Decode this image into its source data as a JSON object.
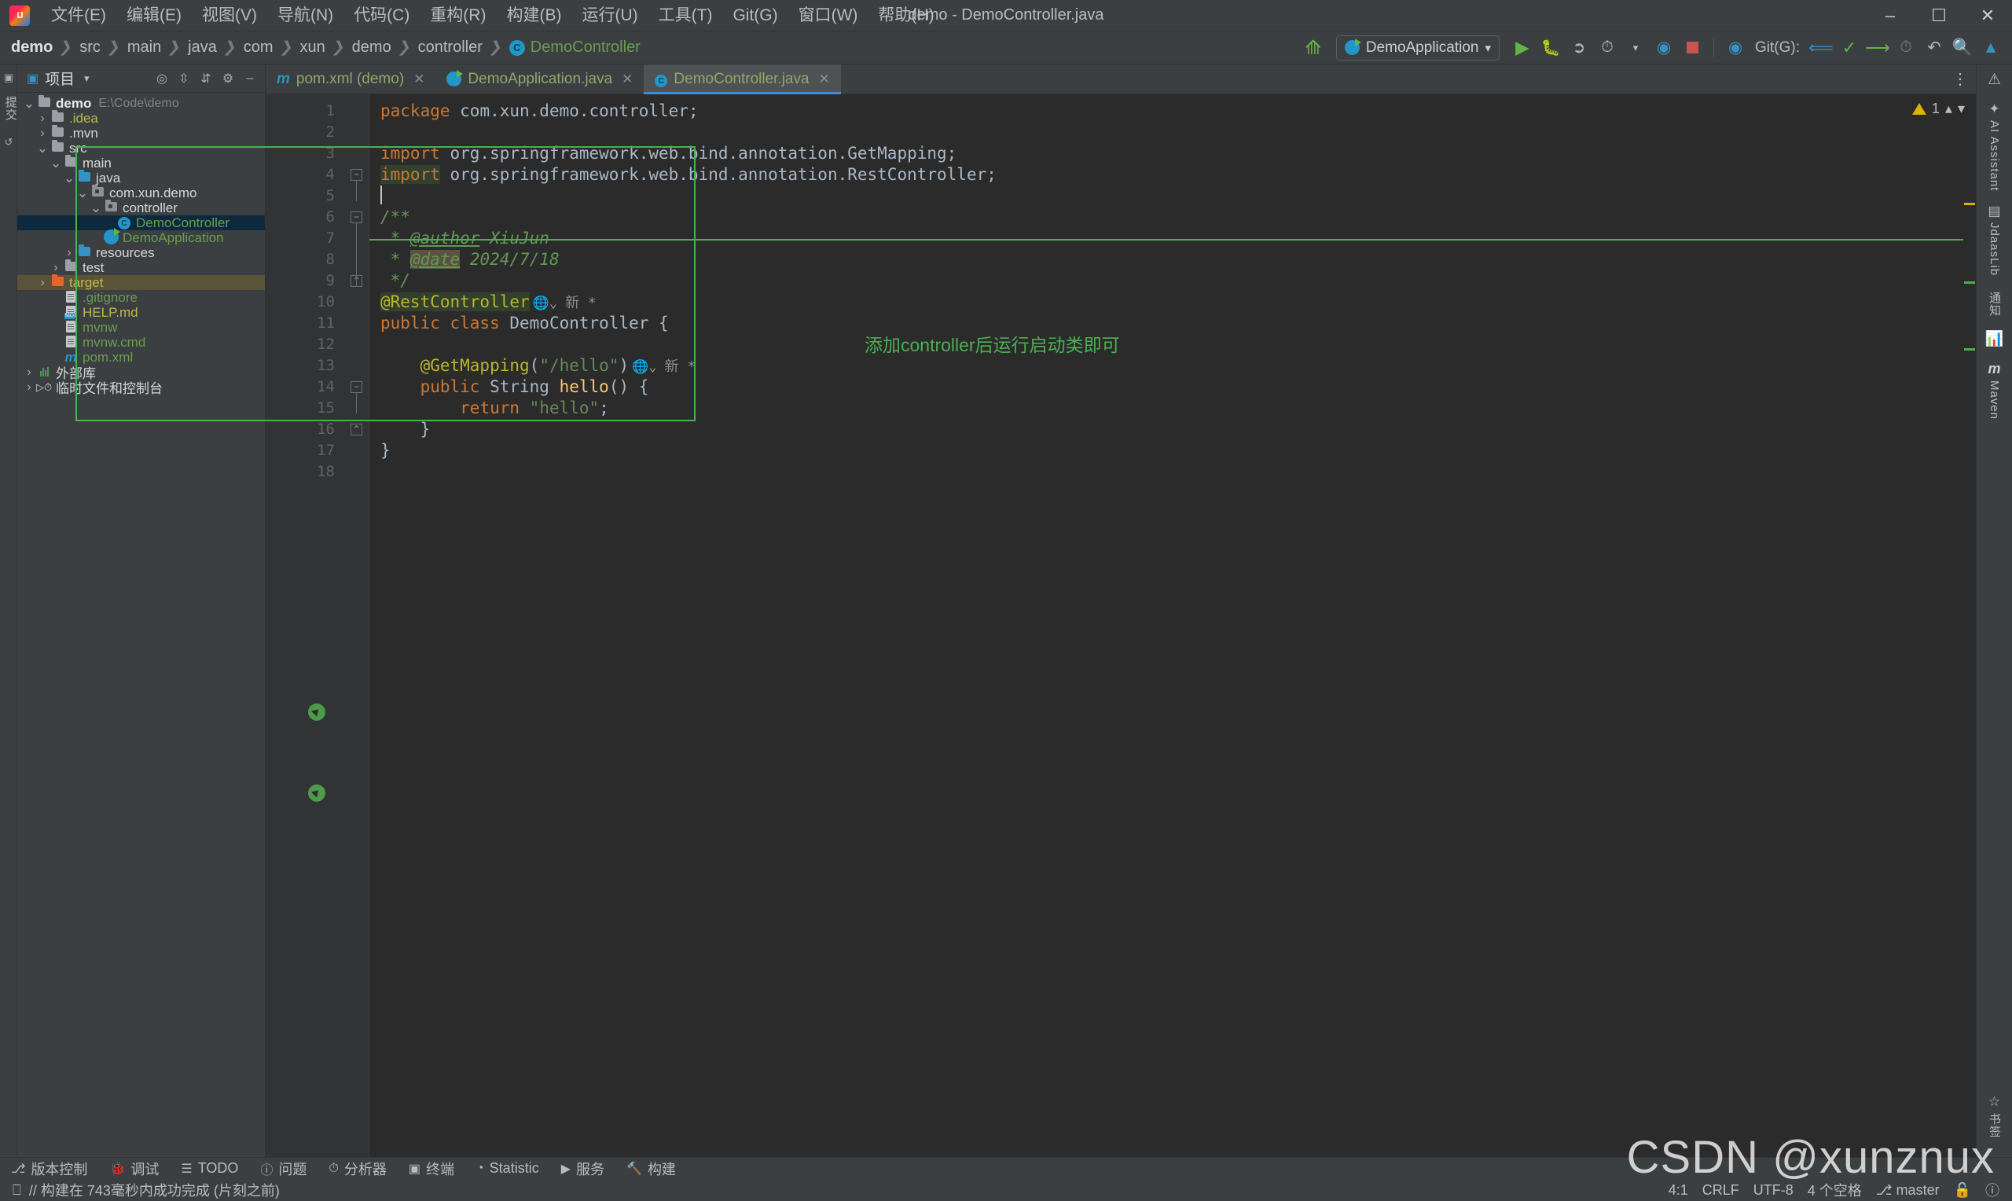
{
  "window": {
    "title": "demo - DemoController.java",
    "logo_icon": "intellij-idea-logo",
    "minimize_icon": "minimize-icon",
    "maximize_icon": "maximize-icon",
    "close_icon": "close-icon"
  },
  "menubar": {
    "items": [
      {
        "label": "文件(E)"
      },
      {
        "label": "编辑(E)"
      },
      {
        "label": "视图(V)"
      },
      {
        "label": "导航(N)"
      },
      {
        "label": "代码(C)"
      },
      {
        "label": "重构(R)"
      },
      {
        "label": "构建(B)"
      },
      {
        "label": "运行(U)"
      },
      {
        "label": "工具(T)"
      },
      {
        "label": "Git(G)"
      },
      {
        "label": "窗口(W)"
      },
      {
        "label": "帮助(H)"
      }
    ]
  },
  "navbar": {
    "breadcrumbs": [
      {
        "label": "demo",
        "style": "root"
      },
      {
        "label": "src",
        "style": "plain"
      },
      {
        "label": "main",
        "style": "plain"
      },
      {
        "label": "java",
        "style": "plain"
      },
      {
        "label": "com",
        "style": "plain"
      },
      {
        "label": "xun",
        "style": "plain"
      },
      {
        "label": "demo",
        "style": "plain"
      },
      {
        "label": "controller",
        "style": "plain"
      },
      {
        "label": "DemoController",
        "style": "leaf"
      }
    ],
    "separator": "❯",
    "run_config": "DemoApplication",
    "run_config_dropdown": "▾",
    "git_label": "Git(G):",
    "icons": [
      "back-arrow-icon",
      "run-icon",
      "debug-icon",
      "run-with-coverage-icon",
      "profiler-icon",
      "stop-icon",
      "spring-icon",
      "git-update-icon",
      "git-commit-icon",
      "git-push-icon",
      "history-icon",
      "rollback-icon",
      "search-icon",
      "updates-icon"
    ]
  },
  "left_strip": {
    "items": [
      {
        "label": "项目",
        "icon": "project-icon"
      },
      {
        "label": "提交",
        "icon": "commit-icon"
      },
      {
        "label": "拉取请求",
        "icon": "pull-request-icon"
      }
    ]
  },
  "project_panel": {
    "title": "项目",
    "dropdown_icon": "chevron-down-icon",
    "tools": [
      "locate-icon",
      "expand-all-icon",
      "collapse-all-icon",
      "settings-icon",
      "hide-icon"
    ],
    "tree": [
      {
        "depth": 0,
        "twisty": "v",
        "icon": "folder-module",
        "label": "demo",
        "style": "bold",
        "path": "E:\\Code\\demo"
      },
      {
        "depth": 1,
        "twisty": ">",
        "icon": "folder",
        "label": ".idea",
        "style": "yellow"
      },
      {
        "depth": 1,
        "twisty": ">",
        "icon": "folder",
        "label": ".mvn",
        "style": "white"
      },
      {
        "depth": 1,
        "twisty": "v",
        "icon": "folder",
        "label": "src",
        "style": "white"
      },
      {
        "depth": 2,
        "twisty": "v",
        "icon": "folder",
        "label": "main",
        "style": "white"
      },
      {
        "depth": 3,
        "twisty": "v",
        "icon": "folder-source",
        "label": "java",
        "style": "white"
      },
      {
        "depth": 4,
        "twisty": "v",
        "icon": "folder-package",
        "label": "com.xun.demo",
        "style": "white"
      },
      {
        "depth": 5,
        "twisty": "v",
        "icon": "folder-package",
        "label": "controller",
        "style": "white"
      },
      {
        "depth": 6,
        "twisty": "",
        "icon": "class-icon",
        "label": "DemoController",
        "style": "green",
        "selected": true
      },
      {
        "depth": 5,
        "twisty": "",
        "icon": "spring-boot-class-icon",
        "label": "DemoApplication",
        "style": "green"
      },
      {
        "depth": 3,
        "twisty": ">",
        "icon": "folder-resources",
        "label": "resources",
        "style": "white"
      },
      {
        "depth": 2,
        "twisty": ">",
        "icon": "folder",
        "label": "test",
        "style": "white"
      },
      {
        "depth": 1,
        "twisty": ">",
        "icon": "folder-excluded",
        "label": "target",
        "style": "yellow",
        "highlight": "target"
      },
      {
        "depth": 2,
        "twisty": "",
        "icon": "gitignore-file-icon",
        "label": ".gitignore",
        "style": "green"
      },
      {
        "depth": 2,
        "twisty": "",
        "icon": "markdown-file-icon",
        "label": "HELP.md",
        "style": "yellow"
      },
      {
        "depth": 2,
        "twisty": "",
        "icon": "file-icon",
        "label": "mvnw",
        "style": "green"
      },
      {
        "depth": 2,
        "twisty": "",
        "icon": "file-icon",
        "label": "mvnw.cmd",
        "style": "green"
      },
      {
        "depth": 2,
        "twisty": "",
        "icon": "maven-file-icon",
        "label": "pom.xml",
        "style": "green"
      },
      {
        "depth": 0,
        "twisty": ">",
        "icon": "external-libraries-icon",
        "label": "外部库",
        "style": "white"
      },
      {
        "depth": 0,
        "twisty": ">",
        "icon": "scratches-icon",
        "label": "临时文件和控制台",
        "style": "white"
      }
    ]
  },
  "editor": {
    "tabs": [
      {
        "label": "pom.xml (demo)",
        "icon": "maven-file-icon",
        "active": false,
        "close_icon": "close-icon"
      },
      {
        "label": "DemoApplication.java",
        "icon": "spring-boot-class-icon",
        "active": false,
        "close_icon": "close-icon"
      },
      {
        "label": "DemoController.java",
        "icon": "class-icon",
        "active": true,
        "close_icon": "close-icon"
      }
    ],
    "more_tabs_icon": "more-options-icon",
    "inspection": {
      "warning_count": "1",
      "up_icon": "chevron-up-icon",
      "down_icon": "chevron-down-icon"
    },
    "line_numbers": [
      "1",
      "2",
      "3",
      "4",
      "5",
      "6",
      "7",
      "8",
      "9",
      "10",
      "11",
      "12",
      "13",
      "14",
      "15",
      "16",
      "17",
      "18"
    ],
    "lines": [
      {
        "n": 1,
        "tokens": [
          {
            "t": "package",
            "c": "kw"
          },
          {
            "t": " com.xun.demo.controller;",
            "c": "plain"
          }
        ]
      },
      {
        "n": 2,
        "tokens": []
      },
      {
        "n": 3,
        "tokens": [
          {
            "t": "import",
            "c": "kw"
          },
          {
            "t": " org.springframework.web.bind.annotation.GetMapping;",
            "c": "plain"
          }
        ]
      },
      {
        "n": 4,
        "tokens": [
          {
            "t": "import",
            "c": "kw hl-green"
          },
          {
            "t": " org.springframework.web.bind.annotation.RestController;",
            "c": "plain"
          }
        ]
      },
      {
        "n": 5,
        "tokens": []
      },
      {
        "n": 6,
        "tokens": [
          {
            "t": "/**",
            "c": "cmt"
          }
        ]
      },
      {
        "n": 7,
        "tokens": [
          {
            "t": " * ",
            "c": "cmt"
          },
          {
            "t": "@author",
            "c": "tag"
          },
          {
            "t": " XiuJun",
            "c": "cmt"
          }
        ]
      },
      {
        "n": 8,
        "tokens": [
          {
            "t": " * ",
            "c": "cmt"
          },
          {
            "t": "@date",
            "c": "tag hl-warn"
          },
          {
            "t": " 2024/7/18",
            "c": "cmt"
          }
        ]
      },
      {
        "n": 9,
        "tokens": [
          {
            "t": " */",
            "c": "cmt"
          }
        ]
      },
      {
        "n": 10,
        "tokens": [
          {
            "t": "@RestController",
            "c": "ann hl-green"
          }
        ],
        "inlay": "新 *",
        "has_web_icon": true
      },
      {
        "n": 11,
        "tokens": [
          {
            "t": "public class ",
            "c": "kw"
          },
          {
            "t": "DemoController",
            "c": "plain"
          },
          {
            "t": " {",
            "c": "plain"
          }
        ],
        "gutter": "run-icon"
      },
      {
        "n": 12,
        "tokens": []
      },
      {
        "n": 13,
        "tokens": [
          {
            "t": "    ",
            "c": "plain"
          },
          {
            "t": "@GetMapping",
            "c": "ann"
          },
          {
            "t": "(",
            "c": "plain"
          },
          {
            "t": "\"/hello\"",
            "c": "str"
          },
          {
            "t": ")",
            "c": "plain"
          }
        ],
        "inlay": "新 *",
        "has_web_icon": true
      },
      {
        "n": 14,
        "tokens": [
          {
            "t": "    ",
            "c": "plain"
          },
          {
            "t": "public ",
            "c": "kw"
          },
          {
            "t": "String ",
            "c": "plain"
          },
          {
            "t": "hello",
            "c": "meth"
          },
          {
            "t": "() {",
            "c": "plain"
          }
        ],
        "gutter": "run-icon"
      },
      {
        "n": 15,
        "tokens": [
          {
            "t": "        ",
            "c": "plain"
          },
          {
            "t": "return ",
            "c": "kw"
          },
          {
            "t": "\"hello\"",
            "c": "str"
          },
          {
            "t": ";",
            "c": "plain"
          }
        ]
      },
      {
        "n": 16,
        "tokens": [
          {
            "t": "    }",
            "c": "plain"
          }
        ]
      },
      {
        "n": 17,
        "tokens": [
          {
            "t": "}",
            "c": "plain"
          }
        ]
      },
      {
        "n": 18,
        "tokens": []
      }
    ],
    "code_text_raw": "package com.xun.demo.controller;\n\nimport org.springframework.web.bind.annotation.GetMapping;\nimport org.springframework.web.bind.annotation.RestController;\n\n/**\n * @author XiuJun\n * @date 2024/7/18\n */\n@RestController\npublic class DemoController {\n\n    @GetMapping(\"/hello\")\n    public String hello() {\n        return \"hello\";\n    }\n}\n",
    "annotation_text": "添加controller后运行启动类即可",
    "annotation_color": "#4caf50",
    "inlay_hint": "新 *"
  },
  "right_strip": {
    "items": [
      {
        "label": "AI Assistant",
        "icon": "ai-assistant-icon"
      },
      {
        "label": "JdaasLib",
        "icon": "database-icon"
      },
      {
        "label": "通知",
        "icon": "notifications-icon"
      },
      {
        "label": "",
        "icon": "chart-icon"
      },
      {
        "label": "Maven",
        "icon": "maven-icon"
      },
      {
        "label": "书签",
        "icon": "bookmarks-icon"
      }
    ]
  },
  "bottom_toolwindows": {
    "items": [
      {
        "label": "版本控制",
        "icon": "version-control-icon"
      },
      {
        "label": "调试",
        "icon": "debug-icon"
      },
      {
        "label": "TODO",
        "icon": "todo-icon"
      },
      {
        "label": "问题",
        "icon": "problems-icon"
      },
      {
        "label": "分析器",
        "icon": "profiler-icon"
      },
      {
        "label": "终端",
        "icon": "terminal-icon"
      },
      {
        "label": "Statistic",
        "icon": "statistic-icon"
      },
      {
        "label": "服务",
        "icon": "services-icon"
      },
      {
        "label": "构建",
        "icon": "build-icon"
      }
    ]
  },
  "status_bar": {
    "build_icon": "build-status-icon",
    "build_message": "// 构建在 743毫秒内成功完成 (片刻之前)",
    "caret_position": "4:1",
    "line_separator": "CRLF",
    "encoding": "UTF-8",
    "indent": "4 个空格",
    "branch": "master",
    "branch_icon": "git-branch-icon",
    "lock_icon": "unlocked-icon",
    "notification_icon": "notification-icon"
  },
  "watermark": {
    "text": "CSDN @xunznux"
  }
}
